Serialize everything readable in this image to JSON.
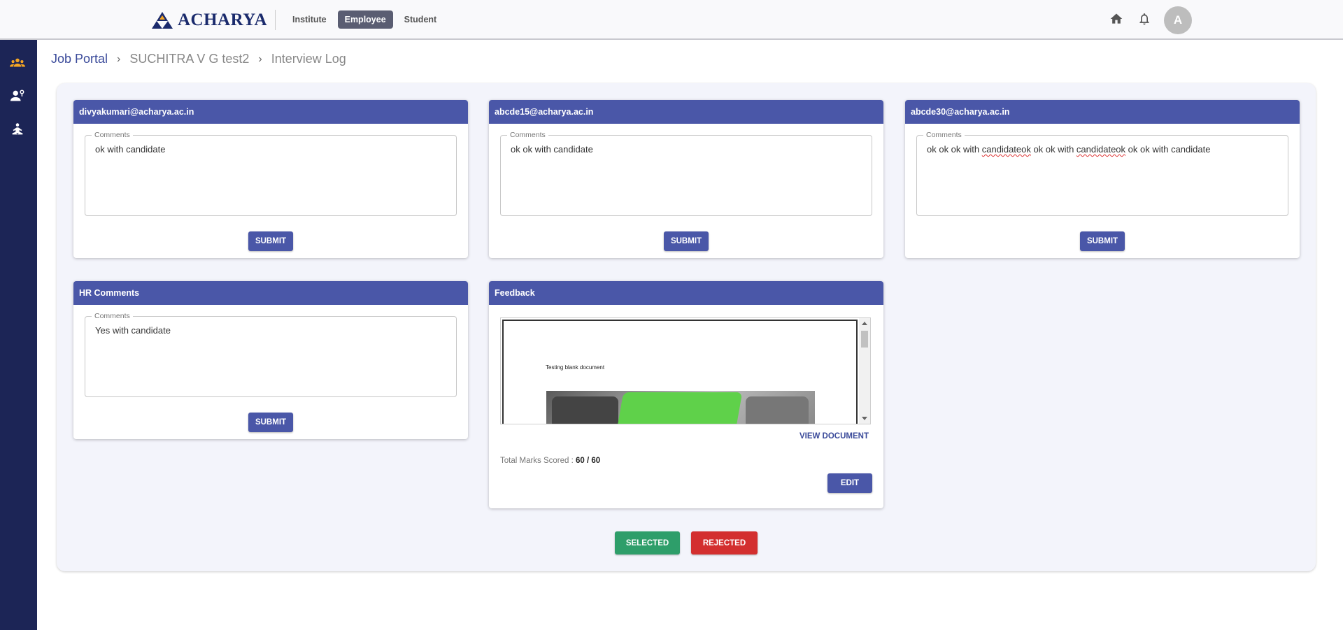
{
  "brand": {
    "name": "ACHARYA",
    "primary": "#4a57a8",
    "sidebar": "#1c2556",
    "accent": "#f5a623"
  },
  "topnav": {
    "tabs": [
      {
        "label": "Institute"
      },
      {
        "label": "Employee"
      },
      {
        "label": "Student"
      }
    ],
    "active": "Employee"
  },
  "top_icons": [
    "home-icon",
    "bell-icon"
  ],
  "user": {
    "initial": "A"
  },
  "sidebar": {
    "items": [
      {
        "icon": "people-group-icon"
      },
      {
        "icon": "user-settings-icon"
      },
      {
        "icon": "person-meditation-icon"
      }
    ]
  },
  "breadcrumb": {
    "items": [
      "Job Portal",
      "SUCHITRA V G test2",
      "Interview Log"
    ]
  },
  "interviewers": [
    {
      "email": "divyakumari@acharya.ac.in",
      "legend": "Comments",
      "comment": "ok with candidate",
      "button": "SUBMIT"
    },
    {
      "email": "abcde15@acharya.ac.in",
      "legend": "Comments",
      "comment": "ok ok with candidate",
      "button": "SUBMIT"
    },
    {
      "email": "abcde30@acharya.ac.in",
      "legend": "Comments",
      "comment_parts": [
        "ok ok ok with ",
        "candidateok",
        " ok ok with ",
        "candidateok",
        " ok ok with candidate"
      ],
      "button": "SUBMIT"
    }
  ],
  "hr": {
    "title": "HR Comments",
    "legend": "Comments",
    "comment": "Yes with candidate",
    "button": "SUBMIT"
  },
  "feedback": {
    "title": "Feedback",
    "document_text": "Testing blank document",
    "view_label": "VIEW DOCUMENT",
    "marks_label": "Total Marks Scored :",
    "marks_value": "60 / 60",
    "edit_label": "EDIT"
  },
  "actions": {
    "selected": "SELECTED",
    "rejected": "REJECTED",
    "selected_color": "#2e9e6a",
    "rejected_color": "#d32f2f"
  }
}
